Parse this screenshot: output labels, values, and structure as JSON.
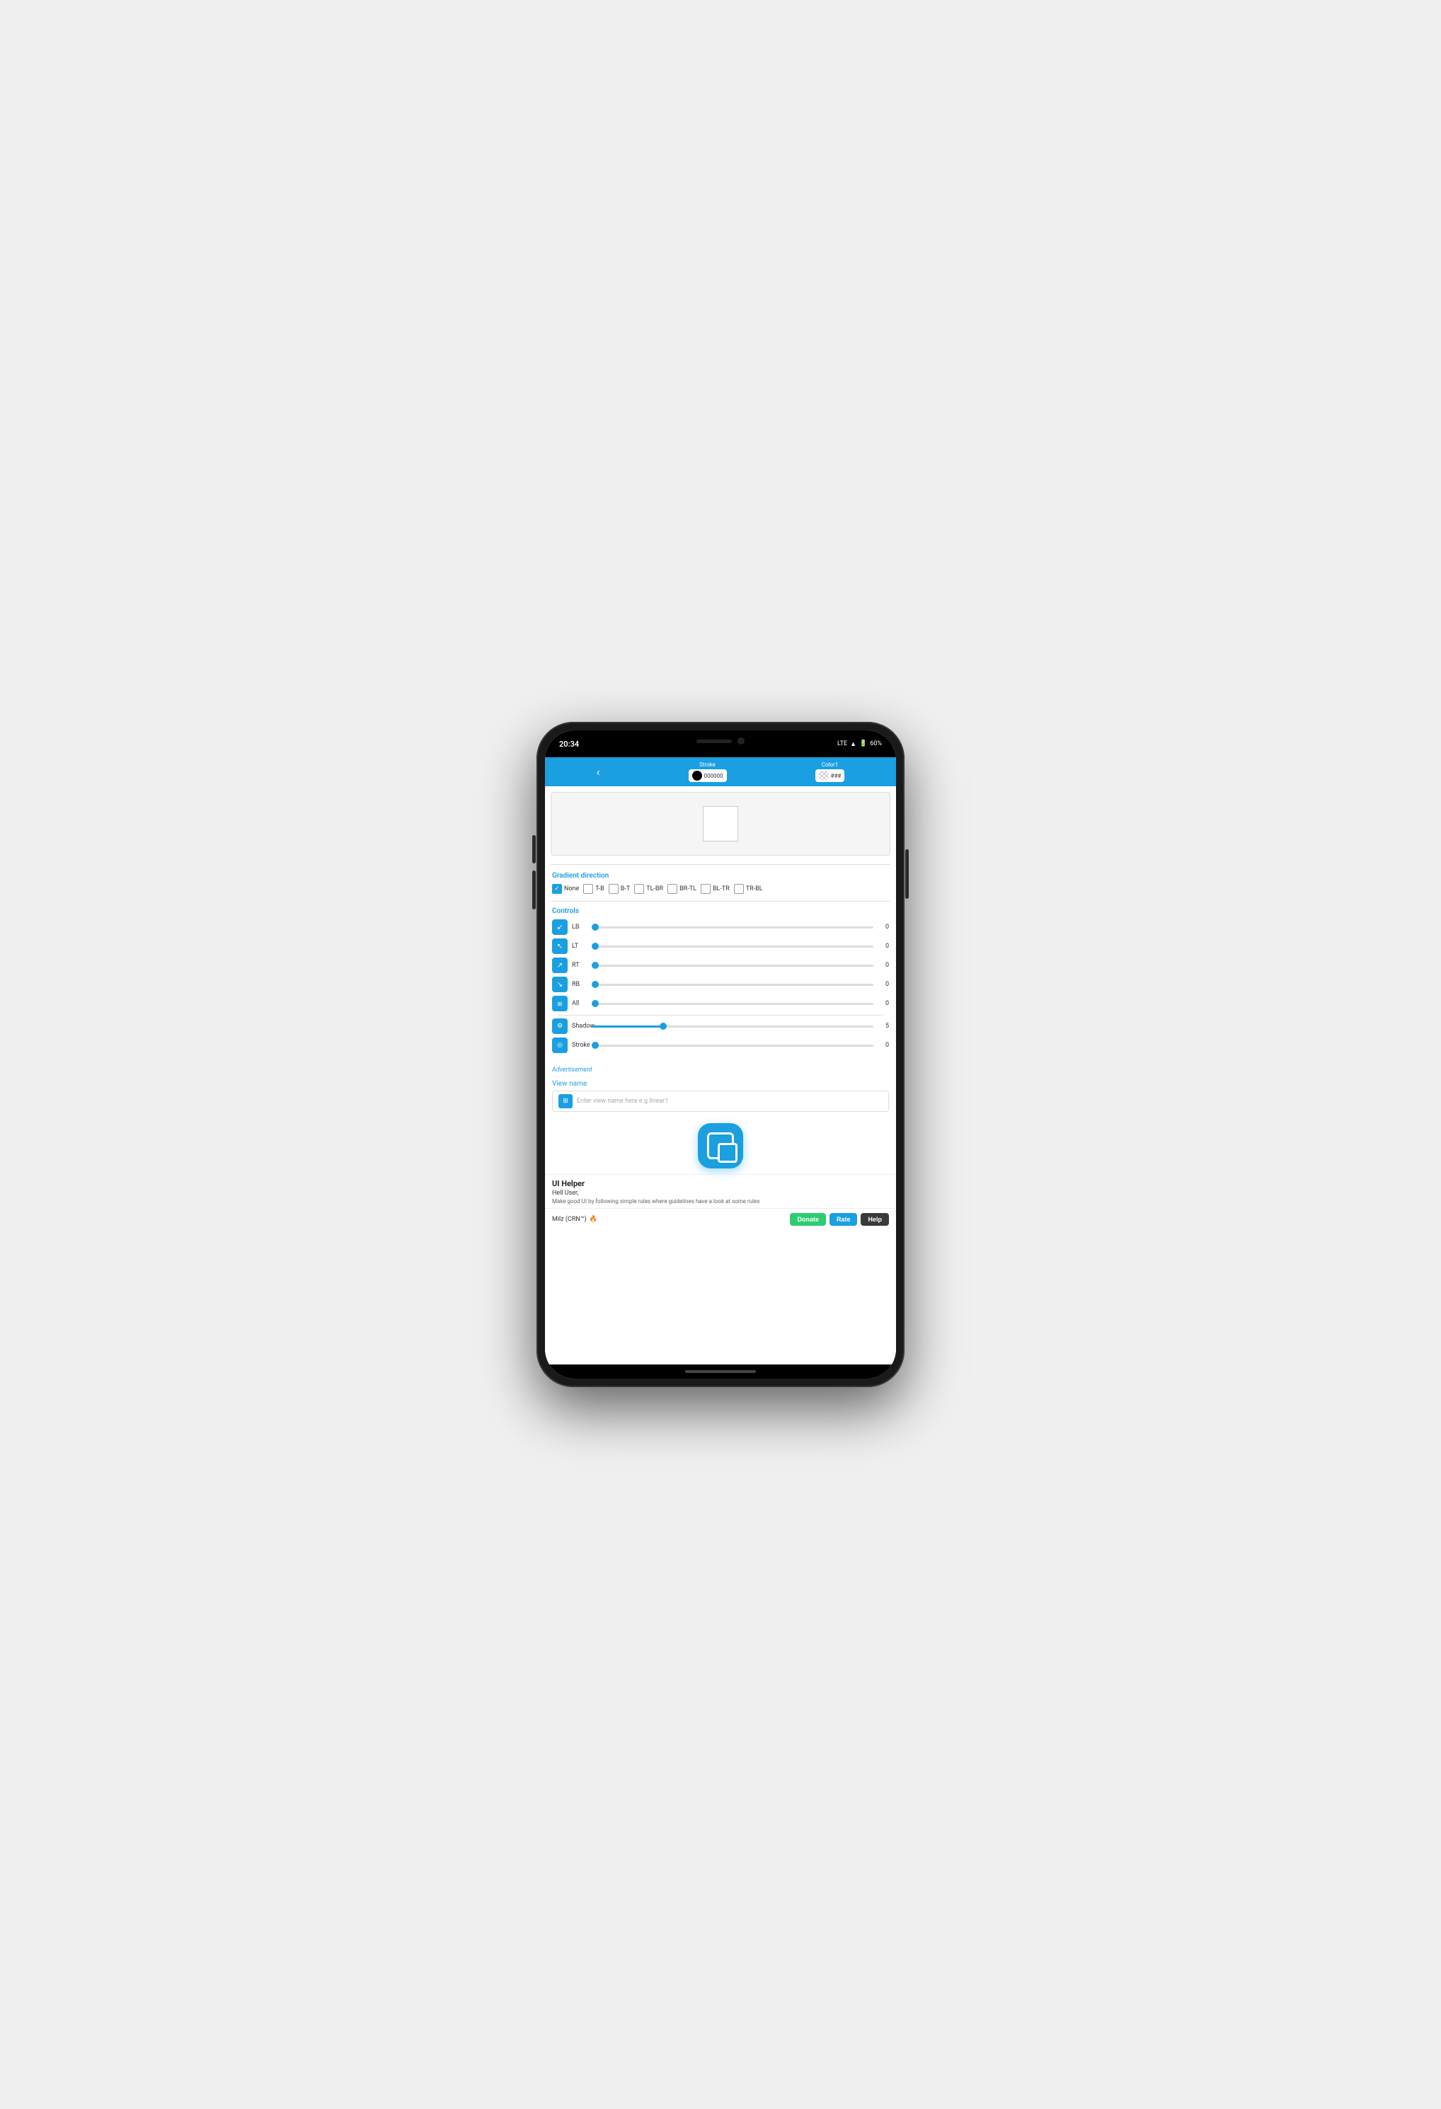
{
  "phone": {
    "status": {
      "time": "20:34",
      "lte": "LTE",
      "battery": "60%"
    },
    "toolbar": {
      "back_icon": "‹",
      "stroke_label": "Stroke",
      "stroke_color": "000000",
      "color1_label": "Color1",
      "color1_hex": "###"
    },
    "gradient": {
      "section_title": "Gradient direction",
      "options": [
        {
          "label": "None",
          "checked": true
        },
        {
          "label": "T-B",
          "checked": false
        },
        {
          "label": "B-T",
          "checked": false
        },
        {
          "label": "TL-BR",
          "checked": false
        },
        {
          "label": "BR-TL",
          "checked": false
        },
        {
          "label": "BL-TR",
          "checked": false
        },
        {
          "label": "TR-BL",
          "checked": false
        }
      ]
    },
    "controls": {
      "section_title": "Controls",
      "items": [
        {
          "icon": "↙",
          "label": "LB",
          "value": 0,
          "fill_pct": 0
        },
        {
          "icon": "↖",
          "label": "LT",
          "value": 0,
          "fill_pct": 0
        },
        {
          "icon": "↗",
          "label": "RT",
          "value": 0,
          "fill_pct": 0
        },
        {
          "icon": "↘",
          "label": "RB",
          "value": 0,
          "fill_pct": 0
        },
        {
          "icon": "⊞",
          "label": "All",
          "value": 0,
          "fill_pct": 0
        }
      ],
      "shadow": {
        "label": "Shadow",
        "value": 5,
        "fill_pct": 25
      },
      "stroke": {
        "label": "Stroke",
        "value": 0,
        "fill_pct": 0
      }
    },
    "advertisement": {
      "label": "Advertisement"
    },
    "view_name": {
      "section_title": "View name",
      "placeholder": "Enter view name here e.g linear1"
    },
    "ui_helper": {
      "title": "UI Helper",
      "greeting": "Hell User,",
      "description": "Make good UI by following simple rules where guidelines have a look at some rules"
    },
    "bottom_bar": {
      "brand": "Milz (CRN™)",
      "fire_icon": "🔥",
      "donate_label": "Donate",
      "rate_label": "Rate",
      "help_label": "Help"
    }
  }
}
